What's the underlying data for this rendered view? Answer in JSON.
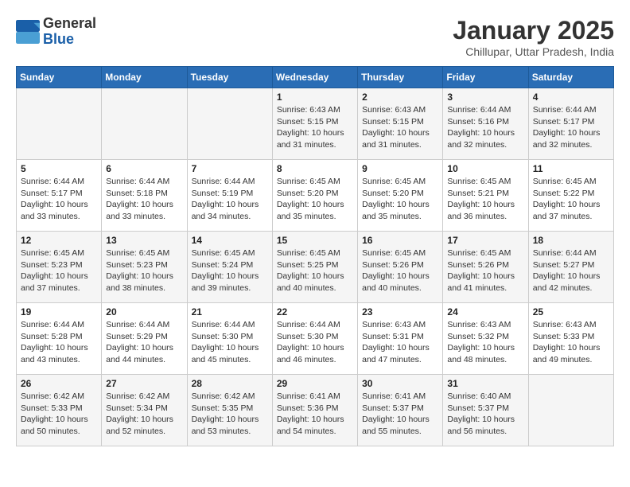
{
  "logo": {
    "text_general": "General",
    "text_blue": "Blue"
  },
  "header": {
    "title": "January 2025",
    "subtitle": "Chillupar, Uttar Pradesh, India"
  },
  "days_of_week": [
    "Sunday",
    "Monday",
    "Tuesday",
    "Wednesday",
    "Thursday",
    "Friday",
    "Saturday"
  ],
  "weeks": [
    [
      {
        "day": "",
        "sunrise": "",
        "sunset": "",
        "daylight": ""
      },
      {
        "day": "",
        "sunrise": "",
        "sunset": "",
        "daylight": ""
      },
      {
        "day": "",
        "sunrise": "",
        "sunset": "",
        "daylight": ""
      },
      {
        "day": "1",
        "sunrise": "Sunrise: 6:43 AM",
        "sunset": "Sunset: 5:15 PM",
        "daylight": "Daylight: 10 hours and 31 minutes."
      },
      {
        "day": "2",
        "sunrise": "Sunrise: 6:43 AM",
        "sunset": "Sunset: 5:15 PM",
        "daylight": "Daylight: 10 hours and 31 minutes."
      },
      {
        "day": "3",
        "sunrise": "Sunrise: 6:44 AM",
        "sunset": "Sunset: 5:16 PM",
        "daylight": "Daylight: 10 hours and 32 minutes."
      },
      {
        "day": "4",
        "sunrise": "Sunrise: 6:44 AM",
        "sunset": "Sunset: 5:17 PM",
        "daylight": "Daylight: 10 hours and 32 minutes."
      }
    ],
    [
      {
        "day": "5",
        "sunrise": "Sunrise: 6:44 AM",
        "sunset": "Sunset: 5:17 PM",
        "daylight": "Daylight: 10 hours and 33 minutes."
      },
      {
        "day": "6",
        "sunrise": "Sunrise: 6:44 AM",
        "sunset": "Sunset: 5:18 PM",
        "daylight": "Daylight: 10 hours and 33 minutes."
      },
      {
        "day": "7",
        "sunrise": "Sunrise: 6:44 AM",
        "sunset": "Sunset: 5:19 PM",
        "daylight": "Daylight: 10 hours and 34 minutes."
      },
      {
        "day": "8",
        "sunrise": "Sunrise: 6:45 AM",
        "sunset": "Sunset: 5:20 PM",
        "daylight": "Daylight: 10 hours and 35 minutes."
      },
      {
        "day": "9",
        "sunrise": "Sunrise: 6:45 AM",
        "sunset": "Sunset: 5:20 PM",
        "daylight": "Daylight: 10 hours and 35 minutes."
      },
      {
        "day": "10",
        "sunrise": "Sunrise: 6:45 AM",
        "sunset": "Sunset: 5:21 PM",
        "daylight": "Daylight: 10 hours and 36 minutes."
      },
      {
        "day": "11",
        "sunrise": "Sunrise: 6:45 AM",
        "sunset": "Sunset: 5:22 PM",
        "daylight": "Daylight: 10 hours and 37 minutes."
      }
    ],
    [
      {
        "day": "12",
        "sunrise": "Sunrise: 6:45 AM",
        "sunset": "Sunset: 5:23 PM",
        "daylight": "Daylight: 10 hours and 37 minutes."
      },
      {
        "day": "13",
        "sunrise": "Sunrise: 6:45 AM",
        "sunset": "Sunset: 5:23 PM",
        "daylight": "Daylight: 10 hours and 38 minutes."
      },
      {
        "day": "14",
        "sunrise": "Sunrise: 6:45 AM",
        "sunset": "Sunset: 5:24 PM",
        "daylight": "Daylight: 10 hours and 39 minutes."
      },
      {
        "day": "15",
        "sunrise": "Sunrise: 6:45 AM",
        "sunset": "Sunset: 5:25 PM",
        "daylight": "Daylight: 10 hours and 40 minutes."
      },
      {
        "day": "16",
        "sunrise": "Sunrise: 6:45 AM",
        "sunset": "Sunset: 5:26 PM",
        "daylight": "Daylight: 10 hours and 40 minutes."
      },
      {
        "day": "17",
        "sunrise": "Sunrise: 6:45 AM",
        "sunset": "Sunset: 5:26 PM",
        "daylight": "Daylight: 10 hours and 41 minutes."
      },
      {
        "day": "18",
        "sunrise": "Sunrise: 6:44 AM",
        "sunset": "Sunset: 5:27 PM",
        "daylight": "Daylight: 10 hours and 42 minutes."
      }
    ],
    [
      {
        "day": "19",
        "sunrise": "Sunrise: 6:44 AM",
        "sunset": "Sunset: 5:28 PM",
        "daylight": "Daylight: 10 hours and 43 minutes."
      },
      {
        "day": "20",
        "sunrise": "Sunrise: 6:44 AM",
        "sunset": "Sunset: 5:29 PM",
        "daylight": "Daylight: 10 hours and 44 minutes."
      },
      {
        "day": "21",
        "sunrise": "Sunrise: 6:44 AM",
        "sunset": "Sunset: 5:30 PM",
        "daylight": "Daylight: 10 hours and 45 minutes."
      },
      {
        "day": "22",
        "sunrise": "Sunrise: 6:44 AM",
        "sunset": "Sunset: 5:30 PM",
        "daylight": "Daylight: 10 hours and 46 minutes."
      },
      {
        "day": "23",
        "sunrise": "Sunrise: 6:43 AM",
        "sunset": "Sunset: 5:31 PM",
        "daylight": "Daylight: 10 hours and 47 minutes."
      },
      {
        "day": "24",
        "sunrise": "Sunrise: 6:43 AM",
        "sunset": "Sunset: 5:32 PM",
        "daylight": "Daylight: 10 hours and 48 minutes."
      },
      {
        "day": "25",
        "sunrise": "Sunrise: 6:43 AM",
        "sunset": "Sunset: 5:33 PM",
        "daylight": "Daylight: 10 hours and 49 minutes."
      }
    ],
    [
      {
        "day": "26",
        "sunrise": "Sunrise: 6:42 AM",
        "sunset": "Sunset: 5:33 PM",
        "daylight": "Daylight: 10 hours and 50 minutes."
      },
      {
        "day": "27",
        "sunrise": "Sunrise: 6:42 AM",
        "sunset": "Sunset: 5:34 PM",
        "daylight": "Daylight: 10 hours and 52 minutes."
      },
      {
        "day": "28",
        "sunrise": "Sunrise: 6:42 AM",
        "sunset": "Sunset: 5:35 PM",
        "daylight": "Daylight: 10 hours and 53 minutes."
      },
      {
        "day": "29",
        "sunrise": "Sunrise: 6:41 AM",
        "sunset": "Sunset: 5:36 PM",
        "daylight": "Daylight: 10 hours and 54 minutes."
      },
      {
        "day": "30",
        "sunrise": "Sunrise: 6:41 AM",
        "sunset": "Sunset: 5:37 PM",
        "daylight": "Daylight: 10 hours and 55 minutes."
      },
      {
        "day": "31",
        "sunrise": "Sunrise: 6:40 AM",
        "sunset": "Sunset: 5:37 PM",
        "daylight": "Daylight: 10 hours and 56 minutes."
      },
      {
        "day": "",
        "sunrise": "",
        "sunset": "",
        "daylight": ""
      }
    ]
  ]
}
